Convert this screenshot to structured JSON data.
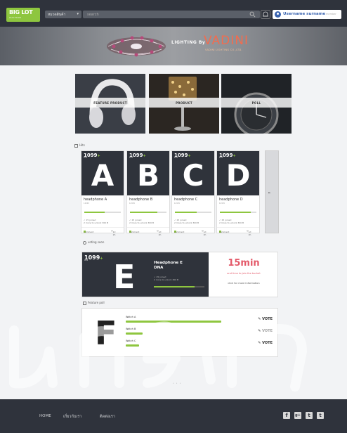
{
  "header": {
    "logo_text": "BIG LOT",
    "logo_sub": "AUCTION",
    "category_label": "หมวดสินค้า",
    "search_placeholder": "search",
    "username": "Username surname",
    "user_sub": "member"
  },
  "banner": {
    "by": "LIGHTING By",
    "brand": "VADINI",
    "company": "VADINI LIGHTING CO.,LTD."
  },
  "tiles": [
    {
      "label": "FEATURE PRODUCT"
    },
    {
      "label": "PRODUCT"
    },
    {
      "label": "POLL"
    }
  ],
  "hits": {
    "title": "Hits",
    "cards": [
      {
        "letter": "A",
        "count": "1099",
        "plus": "+",
        "unit": "bids",
        "name": "headphone A",
        "code": "12345",
        "progress": 0.55,
        "info1": "25 joined",
        "info2": "2 more to unlock 300 B",
        "comment": "comment",
        "time": "1d 2h"
      },
      {
        "letter": "B",
        "count": "1099",
        "plus": "+",
        "unit": "bids",
        "name": "headphone B",
        "code": "12345",
        "progress": 0.75,
        "info1": "25 joined",
        "info2": "2 more to unlock 300 B",
        "comment": "comment",
        "time": "1d 2h"
      },
      {
        "letter": "C",
        "count": "1099",
        "plus": "+",
        "unit": "bids",
        "name": "headphone C",
        "code": "12345",
        "progress": 0.6,
        "info1": "25 joined",
        "info2": "2 more to unlock 300 B",
        "comment": "comment",
        "time": "1d 2h"
      },
      {
        "letter": "D",
        "count": "1099",
        "plus": "+",
        "unit": "bids",
        "name": "headphone D",
        "code": "12345",
        "progress": 0.85,
        "info1": "25 joined",
        "info2": "2 more to unlock 300 B",
        "comment": "comment",
        "time": "1d 2h"
      }
    ],
    "peek_arrow": "next"
  },
  "vote_section": {
    "title": "voting soon",
    "letter": "E",
    "count": "1099",
    "plus": "+",
    "unit": "bids",
    "product_name": "Headphone E",
    "product_sub": "DNA",
    "info1": "25 joined",
    "info2": "2 more to unlock 300 B",
    "progress": 0.8,
    "timer": "15min",
    "timer_sub": "and time to join the bucket",
    "more": "click for more information"
  },
  "poll": {
    "title": "Feature poll",
    "letter": "F",
    "rows": [
      {
        "label": "Watch A",
        "value": 0.85,
        "vote": "VOTE"
      },
      {
        "label": "Watch B",
        "value": 0.15,
        "vote": "VOTE"
      },
      {
        "label": "Watch C",
        "value": 0.12,
        "vote": "VOTE"
      }
    ]
  },
  "pager": "• • •",
  "footer": {
    "links": [
      "HOME",
      "เกี่ยวกับเรา",
      "ติดต่อเรา"
    ],
    "social": [
      "f",
      "g+",
      "t",
      "t"
    ]
  },
  "watermark": "มหาวิทยาลัยศรีปทุม",
  "colors": {
    "accent": "#8ec63f",
    "dark": "#2f333c",
    "timer": "#e45a6a",
    "brand": "#f26c4f",
    "link": "#3a64b0"
  }
}
